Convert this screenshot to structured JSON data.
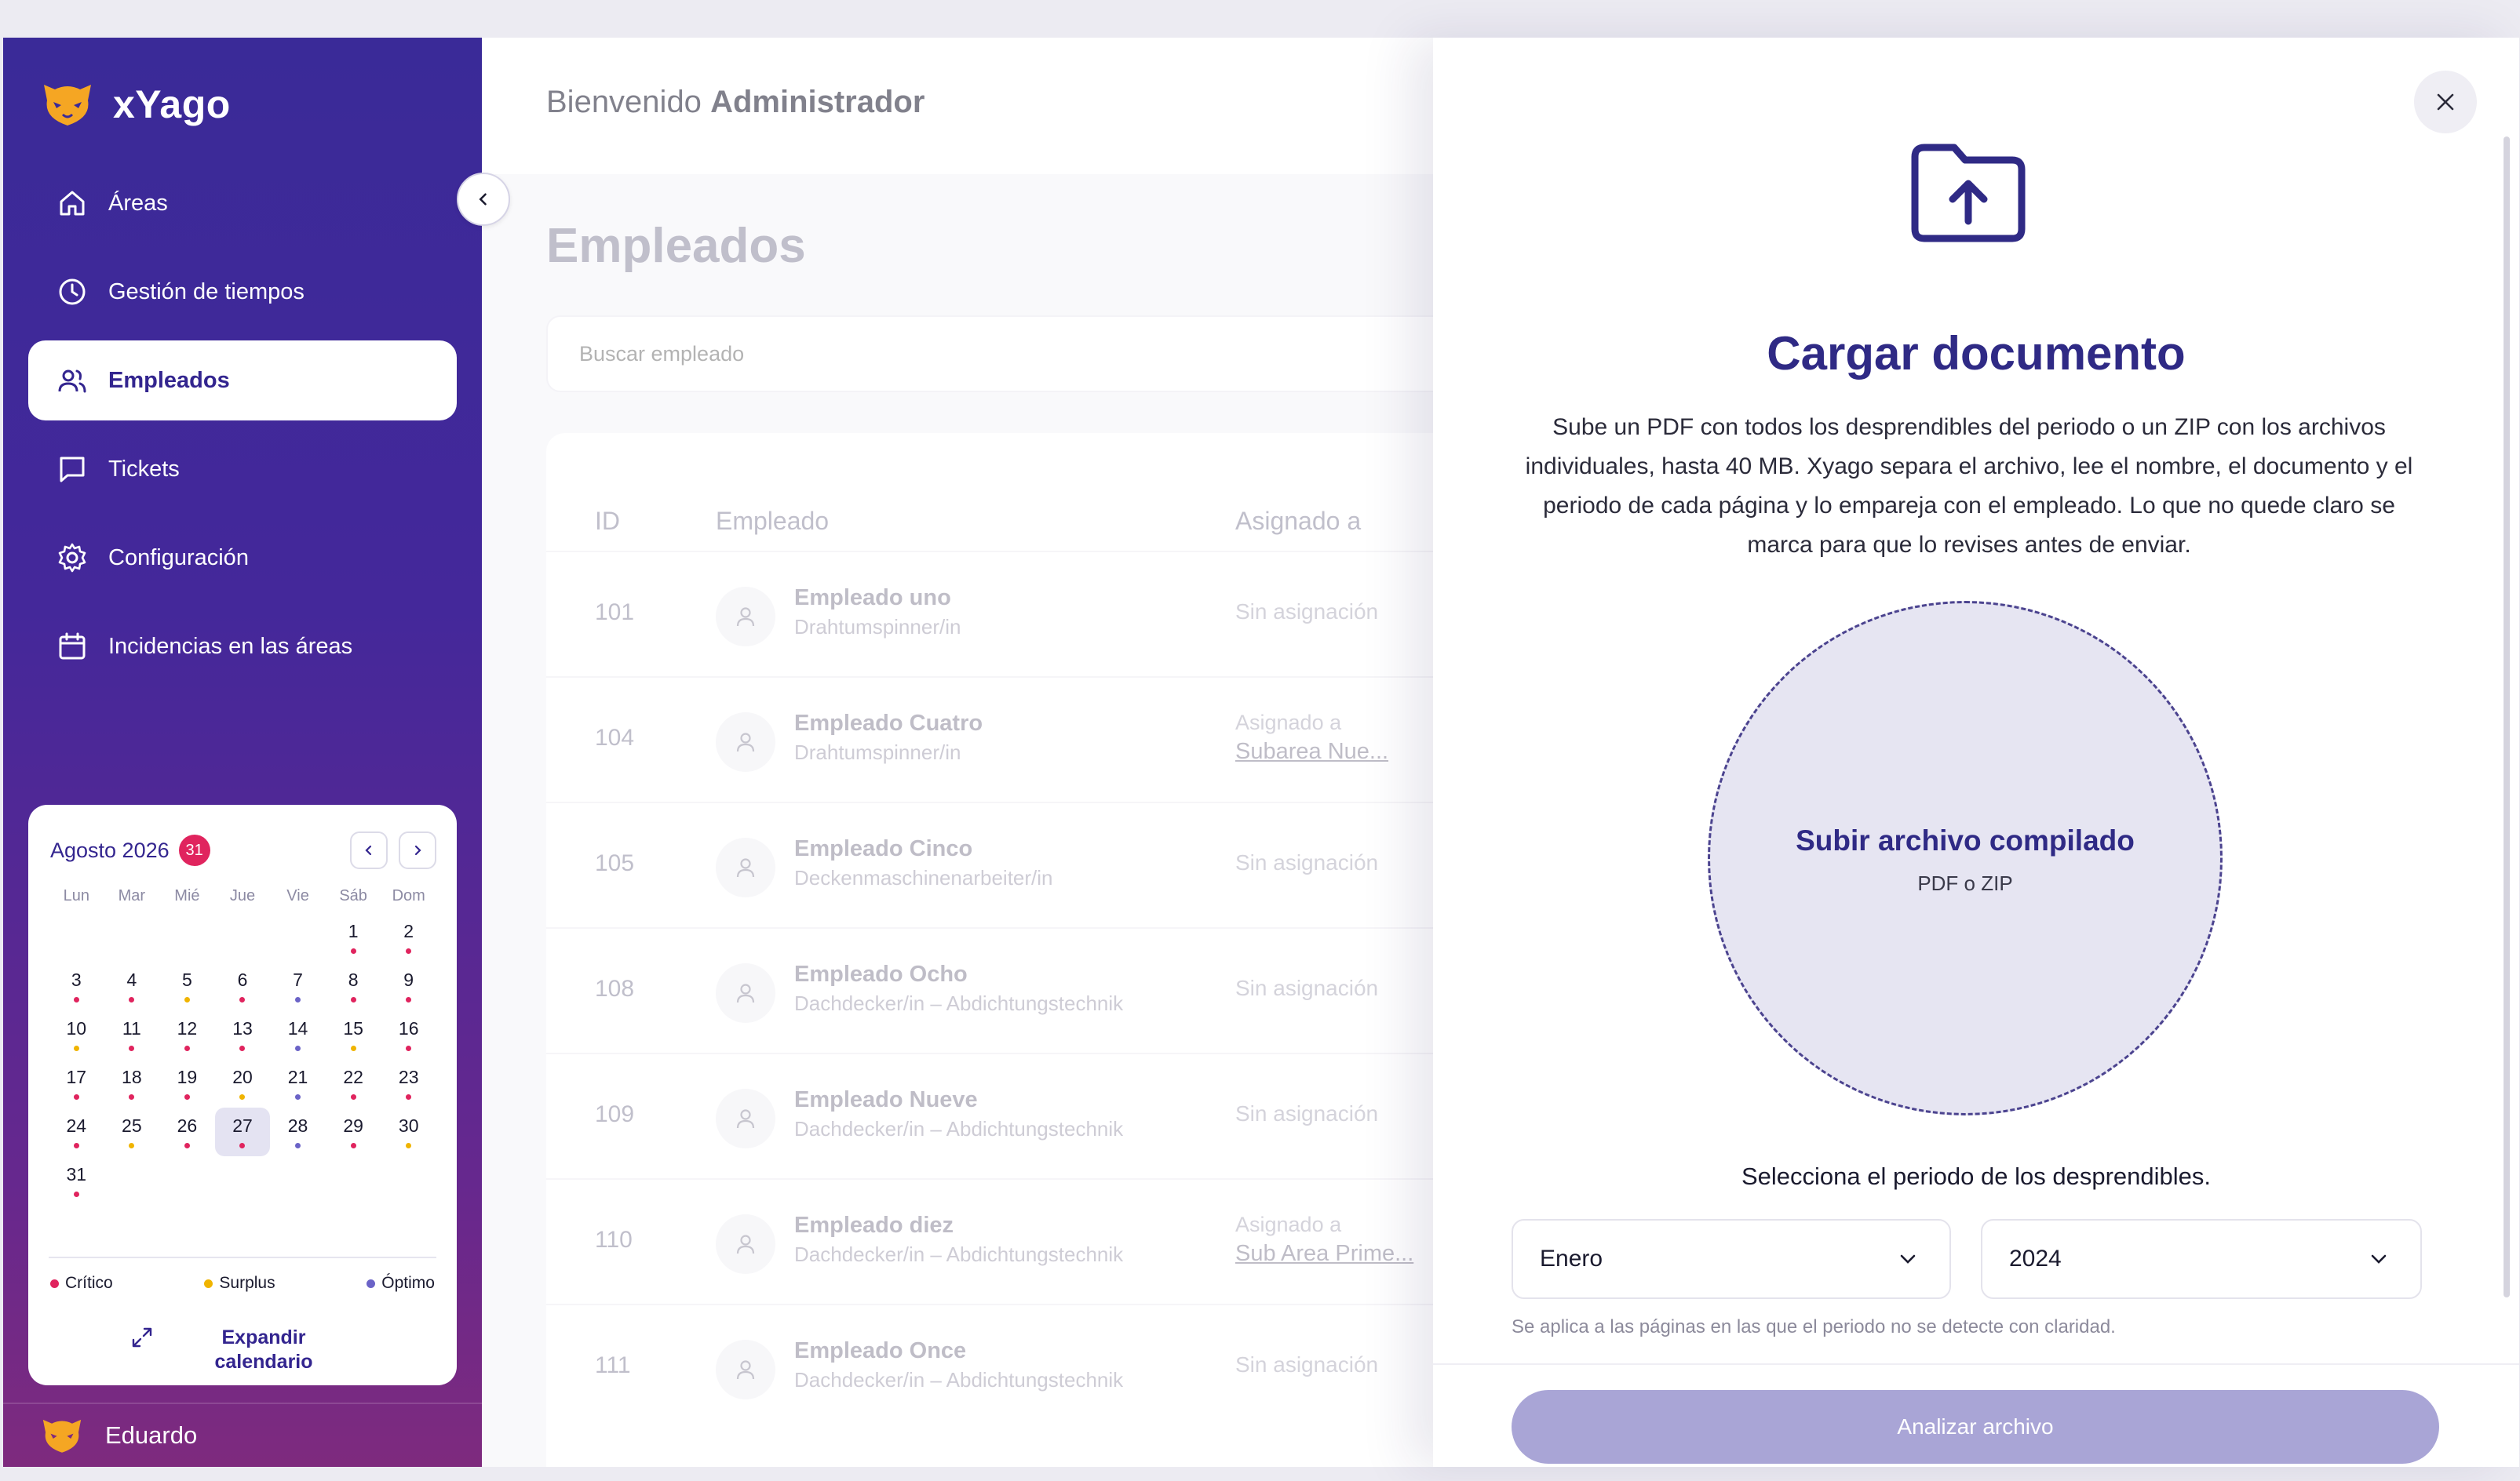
{
  "app": {
    "name": "xYago"
  },
  "sidebar": {
    "items": [
      {
        "label": "Áreas",
        "icon": "home-icon",
        "active": false
      },
      {
        "label": "Gestión de tiempos",
        "icon": "clock-icon",
        "active": false
      },
      {
        "label": "Empleados",
        "icon": "users-icon",
        "active": true
      },
      {
        "label": "Tickets",
        "icon": "message-icon",
        "active": false
      },
      {
        "label": "Configuración",
        "icon": "gear-icon",
        "active": false
      },
      {
        "label": "Incidencias en las áreas",
        "icon": "calendar-icon",
        "active": false
      }
    ],
    "user": {
      "name": "Eduardo"
    }
  },
  "calendar": {
    "title": "Agosto 2026",
    "badge": "31",
    "weekdays": [
      "Lun",
      "Mar",
      "Mié",
      "Jue",
      "Vie",
      "Sáb",
      "Dom"
    ],
    "leading_blanks": 5,
    "today": 27,
    "days": [
      {
        "d": "1",
        "s": "c"
      },
      {
        "d": "2",
        "s": "c"
      },
      {
        "d": "3",
        "s": "c"
      },
      {
        "d": "4",
        "s": "c"
      },
      {
        "d": "5",
        "s": "s"
      },
      {
        "d": "6",
        "s": "c"
      },
      {
        "d": "7",
        "s": "o"
      },
      {
        "d": "8",
        "s": "c"
      },
      {
        "d": "9",
        "s": "c"
      },
      {
        "d": "10",
        "s": "s"
      },
      {
        "d": "11",
        "s": "c"
      },
      {
        "d": "12",
        "s": "c"
      },
      {
        "d": "13",
        "s": "c"
      },
      {
        "d": "14",
        "s": "o"
      },
      {
        "d": "15",
        "s": "s"
      },
      {
        "d": "16",
        "s": "c"
      },
      {
        "d": "17",
        "s": "c"
      },
      {
        "d": "18",
        "s": "c"
      },
      {
        "d": "19",
        "s": "c"
      },
      {
        "d": "20",
        "s": "s"
      },
      {
        "d": "21",
        "s": "o"
      },
      {
        "d": "22",
        "s": "c"
      },
      {
        "d": "23",
        "s": "c"
      },
      {
        "d": "24",
        "s": "c"
      },
      {
        "d": "25",
        "s": "s"
      },
      {
        "d": "26",
        "s": "c"
      },
      {
        "d": "27",
        "s": "c"
      },
      {
        "d": "28",
        "s": "o"
      },
      {
        "d": "29",
        "s": "c"
      },
      {
        "d": "30",
        "s": "s"
      },
      {
        "d": "31",
        "s": "c"
      }
    ],
    "legend": {
      "critico": "Crítico",
      "surplus": "Surplus",
      "optimo": "Óptimo"
    },
    "colors": {
      "critico": "#e0245e",
      "surplus": "#f0b400",
      "optimo": "#6b63c7"
    },
    "expand_label": "Expandir calendario"
  },
  "header": {
    "welcome_prefix": "Bienvenido",
    "welcome_user": "Administrador"
  },
  "page": {
    "title": "Empleados",
    "search_placeholder": "Buscar empleado",
    "columns": {
      "id": "ID",
      "employee": "Empleado",
      "assigned": "Asignado a"
    },
    "rows": [
      {
        "id": "101",
        "name": "Empleado uno",
        "role": "Drahtumspinner/in",
        "assigned": "Sin asignación"
      },
      {
        "id": "104",
        "name": "Empleado Cuatro",
        "role": "Drahtumspinner/in",
        "assigned_prefix": "Asignado a",
        "assigned_link": "Subarea Nue..."
      },
      {
        "id": "105",
        "name": "Empleado Cinco",
        "role": "Deckenmaschinenarbeiter/in",
        "assigned": "Sin asignación"
      },
      {
        "id": "108",
        "name": "Empleado Ocho",
        "role": "Dachdecker/in – Abdichtungstechnik",
        "assigned": "Sin asignación"
      },
      {
        "id": "109",
        "name": "Empleado Nueve",
        "role": "Dachdecker/in – Abdichtungstechnik",
        "assigned": "Sin asignación"
      },
      {
        "id": "110",
        "name": "Empleado diez",
        "role": "Dachdecker/in – Abdichtungstechnik",
        "assigned_prefix": "Asignado a",
        "assigned_link": "Sub Area Prime..."
      },
      {
        "id": "111",
        "name": "Empleado Once",
        "role": "Dachdecker/in – Abdichtungstechnik",
        "assigned": "Sin asignación"
      }
    ]
  },
  "drawer": {
    "title": "Cargar documento",
    "description": "Sube un PDF con todos los desprendibles del periodo o un ZIP con los archivos individuales, hasta 40 MB. Xyago separa el archivo, lee el nombre, el documento y el periodo de cada página y lo empareja con el empleado. Lo que no quede claro se marca para que lo revises antes de enviar.",
    "dropzone_title": "Subir archivo compilado",
    "dropzone_sub": "PDF o ZIP",
    "period_label": "Selecciona el periodo de los desprendibles.",
    "month": "Enero",
    "year": "2024",
    "period_note": "Se aplica a las páginas en las que el periodo no se detecte con claridad.",
    "analyze_label": "Analizar archivo"
  },
  "colors": {
    "accent": "#2f2a85",
    "sidebar_top": "#3a2a98",
    "sidebar_bottom": "#7e2a7e",
    "logo": "#f5a623",
    "button_disabled": "#a9a5d6"
  }
}
